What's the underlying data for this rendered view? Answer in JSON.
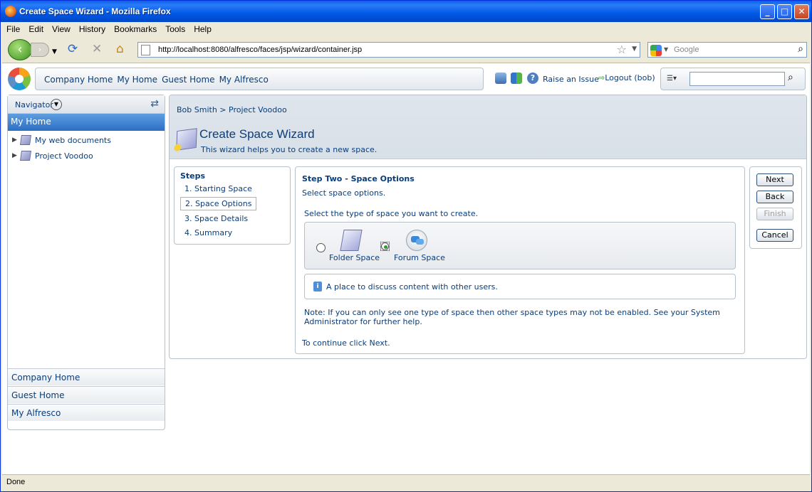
{
  "browser": {
    "title": "Create Space Wizard - Mozilla Firefox",
    "menu": [
      "File",
      "Edit",
      "View",
      "History",
      "Bookmarks",
      "Tools",
      "Help"
    ],
    "url": "http://localhost:8080/alfresco/faces/jsp/wizard/container.jsp",
    "search_placeholder": "Google",
    "status": "Done"
  },
  "header": {
    "links": [
      "Company Home",
      "My Home",
      "Guest Home",
      "My Alfresco"
    ],
    "raise_issue": "Raise an Issue",
    "logout": "Logout (bob)"
  },
  "navigator": {
    "label": "Navigator",
    "selected": "My Home",
    "tree": [
      "My web documents",
      "Project Voodoo"
    ],
    "shortcuts": [
      "Company Home",
      "Guest Home",
      "My Alfresco"
    ]
  },
  "wizard": {
    "breadcrumb": [
      "Bob Smith",
      "Project Voodoo"
    ],
    "breadcrumb_sep": ">",
    "title": "Create Space Wizard",
    "description": "This wizard helps you to create a new space.",
    "steps_heading": "Steps",
    "steps": [
      "1. Starting Space",
      "2. Space Options",
      "3. Space Details",
      "4. Summary"
    ],
    "current_step": 1,
    "step_title": "Step Two - Space Options",
    "step_subtitle": "Select space options.",
    "type_question": "Select the type of space you want to create.",
    "types": [
      {
        "label": "Folder Space",
        "selected": false,
        "icon": "folder-space-icon"
      },
      {
        "label": "Forum Space",
        "selected": true,
        "icon": "forum-space-icon"
      }
    ],
    "info": "A place to discuss content with other users.",
    "note": "Note: If you can only see one type of space then other space types may not be enabled. See your System Administrator for further help.",
    "continue": "To continue click Next.",
    "buttons": {
      "next": "Next",
      "back": "Back",
      "finish": "Finish",
      "cancel": "Cancel"
    }
  }
}
